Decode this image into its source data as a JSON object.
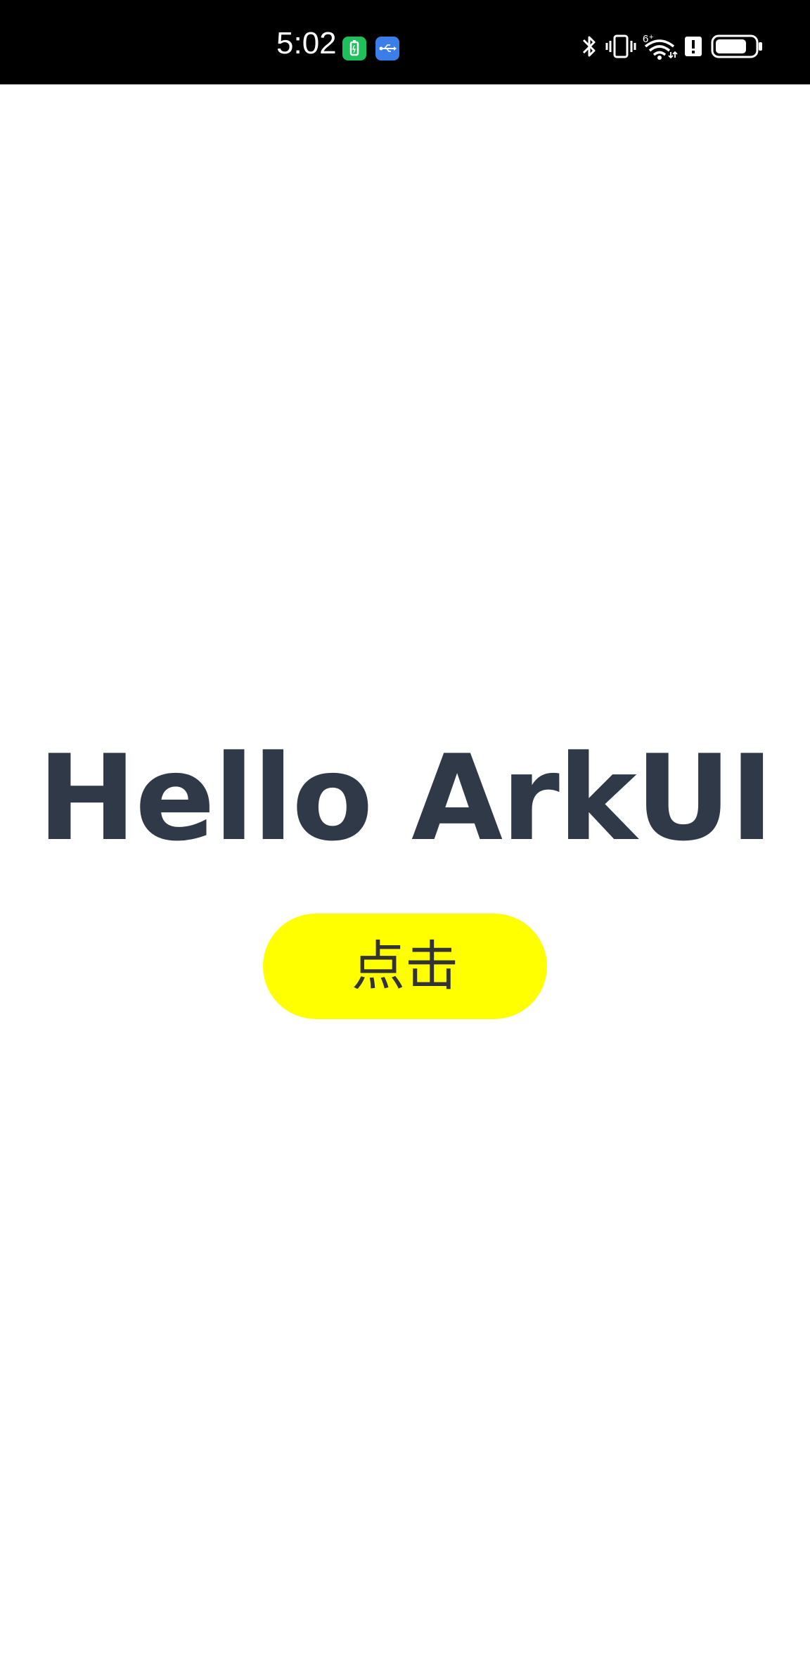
{
  "status_bar": {
    "time": "5:02",
    "icons": [
      "battery-saver-icon",
      "usb-icon",
      "bluetooth-icon",
      "vibrate-icon",
      "wifi-icon",
      "alert-icon",
      "battery-icon"
    ],
    "wifi_badge": "6",
    "battery_level": 0.8
  },
  "main": {
    "title": "Hello ArkUI",
    "button_label": "点击"
  },
  "colors": {
    "status_bar_bg": "#000000",
    "title": "#2f3947",
    "button_bg": "#ffff00",
    "button_text": "#333333"
  }
}
